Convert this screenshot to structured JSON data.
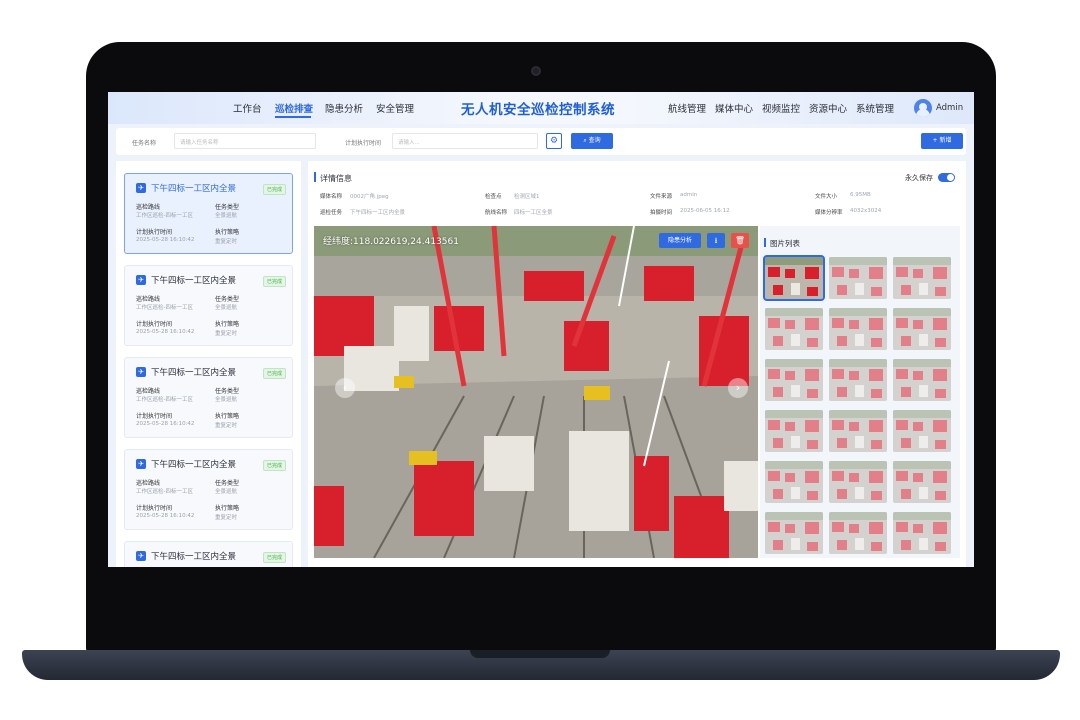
{
  "header": {
    "nav_left": [
      "工作台",
      "巡检排查",
      "隐患分析",
      "安全管理"
    ],
    "active_nav": "巡检排查",
    "title": "无人机安全巡检控制系统",
    "nav_right": [
      "航线管理",
      "媒体中心",
      "视频监控",
      "资源中心",
      "系统管理"
    ],
    "user": "Admin"
  },
  "search": {
    "task_name_label": "任务名称",
    "task_name_placeholder": "请输入任务名称",
    "plan_time_label": "计划执行时间",
    "plan_time_placeholder": "请输入...",
    "query_label": "查询",
    "add_label": "+ 新增"
  },
  "tasks": [
    {
      "title": "下午四标一工区内全景",
      "tag": "已完成",
      "route_label": "巡检路线",
      "route": "工作区巡检-四标一工区",
      "type_label": "任务类型",
      "type": "全景巡航",
      "time_label": "计划执行时间",
      "time": "2025-05-28 16:10:42",
      "strategy_label": "执行策略",
      "strategy": "重复定时"
    },
    {
      "title": "下午四标一工区内全景",
      "tag": "已完成",
      "route_label": "巡检路线",
      "route": "工作区巡检-四标一工区",
      "type_label": "任务类型",
      "type": "全景巡航",
      "time_label": "计划执行时间",
      "time": "2025-05-28 16:10:42",
      "strategy_label": "执行策略",
      "strategy": "重复定时"
    },
    {
      "title": "下午四标一工区内全景",
      "tag": "已完成",
      "route_label": "巡检路线",
      "route": "工作区巡检-四标一工区",
      "type_label": "任务类型",
      "type": "全景巡航",
      "time_label": "计划执行时间",
      "time": "2025-05-28 16:10:42",
      "strategy_label": "执行策略",
      "strategy": "重复定时"
    },
    {
      "title": "下午四标一工区内全景",
      "tag": "已完成",
      "route_label": "巡检路线",
      "route": "工作区巡检-四标一工区",
      "type_label": "任务类型",
      "type": "全景巡航",
      "time_label": "计划执行时间",
      "time": "2025-05-28 16:10:42",
      "strategy_label": "执行策略",
      "strategy": "重复定时"
    },
    {
      "title": "下午四标一工区内全景",
      "tag": "已完成"
    }
  ],
  "detail": {
    "section_title": "详情信息",
    "permanent_label": "永久保存",
    "permanent_on": true,
    "media_name_label": "媒体名称",
    "media_name": "0002广角.jpeg",
    "checkpoint_label": "检查点",
    "checkpoint": "检测区域1",
    "source_label": "文件来源",
    "source": "admin",
    "size_label": "文件大小",
    "size": "6.95MB",
    "task_label": "巡检任务",
    "task": "下午四标一工区内全景",
    "route_label": "航线名称",
    "route": "四标一工区全景",
    "shot_time_label": "拍摄时间",
    "shot_time": "2025-06-05 16:12",
    "resolution_label": "媒体分辨率",
    "resolution": "4032x3024"
  },
  "photo": {
    "coordinates": "经纬度:118.022619,24.413561",
    "analyze_label": "隐患分析",
    "download_icon": "download-icon",
    "delete_icon": "trash-icon"
  },
  "gallery": {
    "title": "图片列表",
    "count": 18,
    "selected_index": 0
  },
  "colors": {
    "accent": "#2f6ae0",
    "danger": "#e8504a",
    "success": "#4caf50",
    "crane_red": "#d8202c"
  }
}
